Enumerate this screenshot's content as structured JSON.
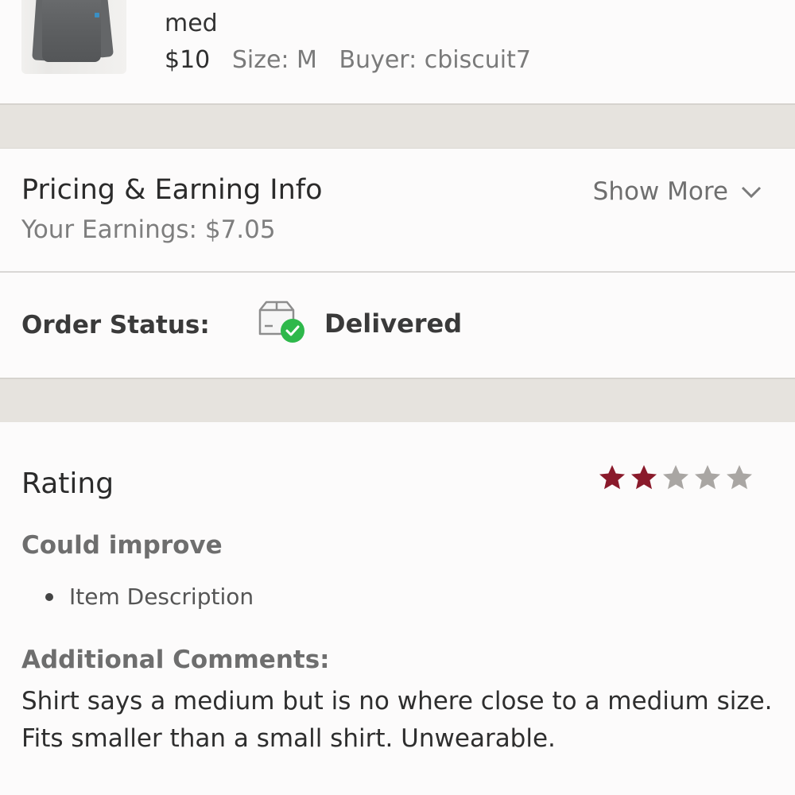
{
  "item": {
    "title_tail": "med",
    "price": "$10",
    "size": "Size: M",
    "buyer": "Buyer: cbiscuit7",
    "thumbnail_icon": "shirt-photo"
  },
  "pricing": {
    "title": "Pricing & Earning Info",
    "earnings": "Your Earnings: $7.05",
    "show_more": "Show More",
    "show_more_icon": "chevron-down-icon"
  },
  "order": {
    "label": "Order Status:",
    "status": "Delivered",
    "status_icon": "package-delivered-icon",
    "check_color": "#2eb84b"
  },
  "rating": {
    "title": "Rating",
    "stars_filled": 2,
    "stars_total": 5,
    "filled_color": "#8a1a2b",
    "empty_color": "#a9a6a3",
    "could_improve_label": "Could improve",
    "improve_items": [
      "Item Description"
    ],
    "comments_label": "Additional Comments:",
    "comments_text": "Shirt says a medium but is no where close to a medium size. Fits smaller than a small shirt. Unwearable."
  }
}
